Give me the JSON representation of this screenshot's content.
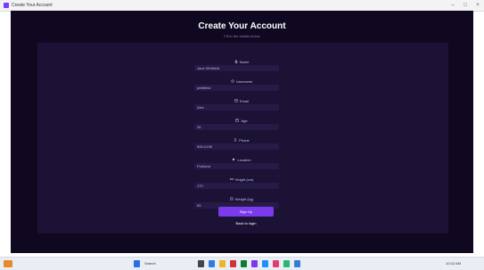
{
  "window": {
    "title": "Create Your Account",
    "controls": {
      "minimize": "–",
      "maximize": "□",
      "close": "×"
    }
  },
  "page": {
    "heading": "Create Your Account",
    "subheading": "Fill in the details below"
  },
  "form": {
    "fields": [
      {
        "label": "Name",
        "icon": "user-icon",
        "value": "Jane Whitfield"
      },
      {
        "label": "Username",
        "icon": "at-icon",
        "value": "jwhitfield"
      },
      {
        "label": "Email",
        "icon": "mail-icon",
        "value": "Alex"
      },
      {
        "label": "Age",
        "icon": "calendar-icon",
        "value": "26"
      },
      {
        "label": "Phone",
        "icon": "phone-icon",
        "value": "555-0198"
      },
      {
        "label": "Location",
        "icon": "pin-icon",
        "value": "Portland"
      },
      {
        "label": "Height (cm)",
        "icon": "ruler-icon",
        "value": "170"
      },
      {
        "label": "Weight (kg)",
        "icon": "scale-icon",
        "value": "65"
      }
    ],
    "submit_label": "Sign Up",
    "back_link": "Back to login"
  },
  "colors": {
    "app_bg": "#0f0820",
    "card_bg": "#1b1236",
    "input_bg": "#261a47",
    "accent": "#7c3aed"
  },
  "taskbar": {
    "search_placeholder": "Search",
    "clock": "10:42 AM"
  }
}
